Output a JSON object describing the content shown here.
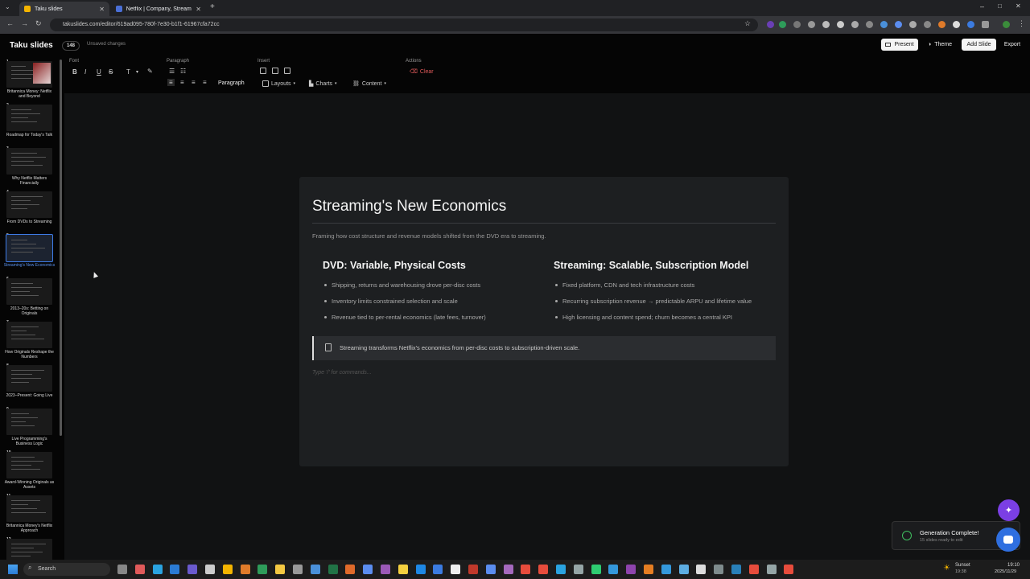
{
  "browser": {
    "tabs": [
      {
        "title": "Taku slides",
        "active": true,
        "color": "#f4b400"
      },
      {
        "title": "Netflix | Company, Streaming, ...",
        "active": false,
        "color": "#4a6fd6"
      }
    ],
    "url": "takuslides.com/editor/619ad095-780f-7e30-b1f1-61967cfa72cc"
  },
  "app": {
    "brand": "Taku slides",
    "badge": "148",
    "unsaved": "Unsaved changes",
    "buttons": {
      "present": "Present",
      "theme": "Theme",
      "add_slide": "Add Slide",
      "export": "Export"
    }
  },
  "toolbar": {
    "groups": {
      "font": "Font",
      "paragraph": "Paragraph",
      "insert": "Insert",
      "actions": "Actions"
    },
    "font_tools": [
      "B",
      "I",
      "U",
      "S",
      "T"
    ],
    "paragraph_label": "Paragraph",
    "layouts": "Layouts",
    "charts": "Charts",
    "content": "Content",
    "clear": "Clear",
    "clear_color": "#e05a5a"
  },
  "slides": [
    {
      "num": "1",
      "title": "Britannica Money: Netflix and Beyond"
    },
    {
      "num": "2",
      "title": "Roadmap for Today's Talk"
    },
    {
      "num": "3",
      "title": "Why Netflix Matters Financially"
    },
    {
      "num": "4",
      "title": "From DVDs to Streaming"
    },
    {
      "num": "5",
      "title": "Streaming's New Economics",
      "selected": true
    },
    {
      "num": "6",
      "title": "2013–20s: Betting on Originals"
    },
    {
      "num": "7",
      "title": "How Originals Reshape the Numbers"
    },
    {
      "num": "8",
      "title": "2023–Present: Going Live"
    },
    {
      "num": "9",
      "title": "Live Programming's Business Logic"
    },
    {
      "num": "10",
      "title": "Award-Winning Originals as Assets"
    },
    {
      "num": "11",
      "title": "Britannica Money's Netflix Approach"
    },
    {
      "num": "12",
      "title": ""
    }
  ],
  "slide": {
    "title": "Streaming's New Economics",
    "subtitle": "Framing how cost structure and revenue models shifted from the DVD era to streaming.",
    "left": {
      "heading": "DVD: Variable, Physical Costs",
      "bullets": [
        "Shipping, returns and warehousing drove per-disc costs",
        "Inventory limits constrained selection and scale",
        "Revenue tied to per-rental economics (late fees, turnover)"
      ]
    },
    "right": {
      "heading": "Streaming: Scalable, Subscription Model",
      "bullets": [
        "Fixed platform, CDN and tech infrastructure costs",
        "Recurring subscription revenue → predictable ARPU and lifetime value",
        "High licensing and content spend; churn becomes a central KPI"
      ]
    },
    "callout": "Streaming transforms Netflix's economics from per-disc costs to subscription-driven scale.",
    "command_placeholder": "Type '/' for commands..."
  },
  "toast": {
    "title": "Generation Complete!",
    "subtitle": "15 slides ready to edit"
  },
  "taskbar": {
    "search": "Search",
    "weather": "Sunset",
    "weather_time": "19:38",
    "clock_time": "19:10",
    "clock_date": "2025/11/29"
  }
}
